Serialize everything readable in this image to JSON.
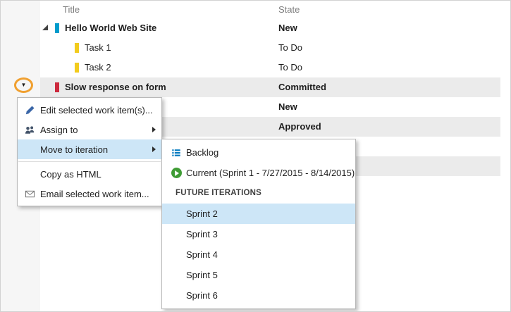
{
  "grid": {
    "columns": [
      "Title",
      "State"
    ],
    "rows": [
      {
        "title": "Hello World Web Site",
        "state": "New"
      },
      {
        "title": "Task 1",
        "state": "To Do"
      },
      {
        "title": "Task 2",
        "state": "To Do"
      },
      {
        "title": "Slow response on form",
        "state": "Committed"
      },
      {
        "title": "",
        "state": "New"
      },
      {
        "title": "",
        "state": "Approved"
      }
    ]
  },
  "callout": {
    "caret": "▼"
  },
  "context_menu": {
    "edit": "Edit selected work item(s)...",
    "assign_to": "Assign to",
    "move_to_iteration": "Move to iteration",
    "copy_as_html": "Copy as HTML",
    "email": "Email selected work item..."
  },
  "iteration_submenu": {
    "backlog": "Backlog",
    "current": "Current (Sprint 1 - 7/27/2015 - 8/14/2015)",
    "future_header": "FUTURE ITERATIONS",
    "sprints": [
      "Sprint 2",
      "Sprint 3",
      "Sprint 4",
      "Sprint 5",
      "Sprint 6"
    ]
  },
  "colors": {
    "pbi_bar": "#009ccc",
    "task_bar": "#f2cb1d",
    "bug_bar": "#cc293d",
    "selected_row": "#ebebeb",
    "menu_highlight": "#cde6f7",
    "callout_orange": "#f0a030",
    "sprint_green": "#3f9c35",
    "pencil_blue": "#3a66a7",
    "people_slate": "#44546a",
    "backlog_blue": "#0079bf",
    "email_gray": "#6a6a6a"
  }
}
